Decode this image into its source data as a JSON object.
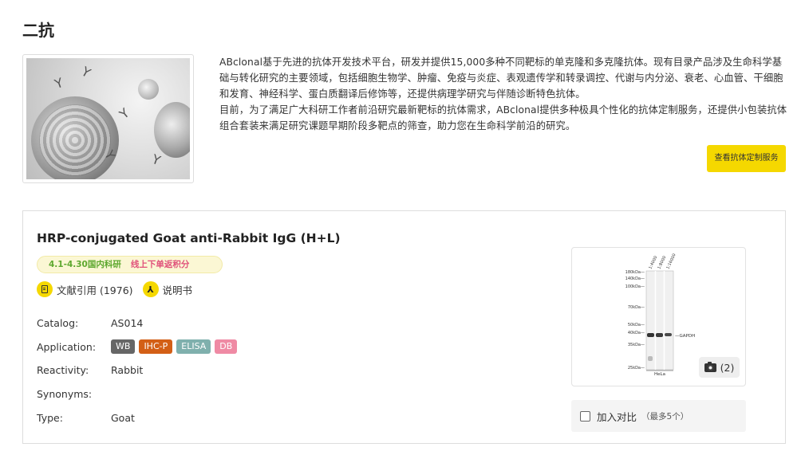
{
  "page": {
    "title": "二抗"
  },
  "intro": {
    "paragraph1": "ABclonal基于先进的抗体开发技术平台，研发并提供15,000多种不同靶标的单克隆和多克隆抗体。现有目录产品涉及生命科学基础与转化研究的主要领域，包括细胞生物学、肿瘤、免疫与炎症、表观遗传学和转录调控、代谢与内分泌、衰老、心血管、干细胞和发育、神经科学、蛋白质翻译后修饰等，还提供病理学研究与伴随诊断特色抗体。",
    "paragraph2": "目前，为了满足广大科研工作者前沿研究最新靶标的抗体需求，ABclonal提供多种极具个性化的抗体定制服务，还提供小包装抗体组合套装来满足研究课题早期阶段多靶点的筛查，助力您在生命科学前沿的研究。",
    "button_label": "查看抗体定制服务"
  },
  "product": {
    "name": "HRP-conjugated Goat anti-Rabbit IgG (H+L)",
    "promo_date": "4.1-4.30国内科研",
    "promo_text": "线上下单返积分",
    "citation_label": "文献引用 (1976)",
    "manual_label": "说明书",
    "catalog_label": "Catalog:",
    "catalog_value": "AS014",
    "application_label": "Application:",
    "applications": [
      {
        "label": "WB",
        "color": "#666666"
      },
      {
        "label": "IHC-P",
        "color": "#d35f16"
      },
      {
        "label": "ELISA",
        "color": "#7fb0ad"
      },
      {
        "label": "DB",
        "color": "#ef8aa4"
      }
    ],
    "reactivity_label": "Reactivity:",
    "reactivity_value": "Rabbit",
    "synonyms_label": "Synonyms:",
    "synonyms_value": "",
    "type_label": "Type:",
    "type_value": "Goat",
    "image_count": "(2)",
    "compare_label": "加入对比",
    "compare_note": "（最多5个）"
  },
  "blot": {
    "markers": [
      "180kDa—",
      "140kDa—",
      "100kDa—",
      "70kDa—",
      "50kDa—",
      "40kDa—",
      "35kDa—",
      "25kDa—"
    ],
    "lanes": [
      "1:4000",
      "1:8000",
      "1:16000"
    ],
    "band_label": "—GAPDH",
    "cell_label": "HeLa"
  }
}
